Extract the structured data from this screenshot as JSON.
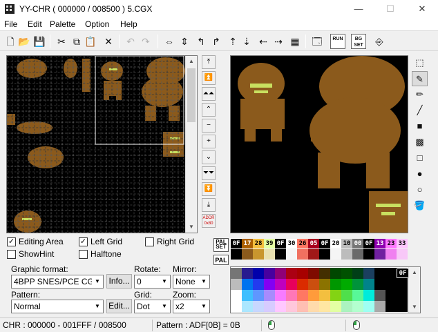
{
  "window": {
    "title": "YY-CHR ( 000000 / 008500 ) 5.CGX",
    "minimize": "—",
    "maximize": "☐",
    "close": "✕"
  },
  "menu": [
    {
      "label": "File",
      "key": "F"
    },
    {
      "label": "Edit",
      "key": "E"
    },
    {
      "label": "Palette",
      "key": "P"
    },
    {
      "label": "Option",
      "key": "O"
    },
    {
      "label": "Help",
      "key": "H"
    }
  ],
  "toolbar": [
    {
      "name": "new-icon",
      "glyph": "🗋",
      "enabled": true
    },
    {
      "name": "open-icon",
      "glyph": "📂",
      "enabled": true
    },
    {
      "name": "save-icon",
      "glyph": "💾",
      "enabled": true
    },
    {
      "name": "cut-icon",
      "glyph": "✂",
      "enabled": true
    },
    {
      "name": "copy-icon",
      "glyph": "⧉",
      "enabled": true
    },
    {
      "name": "paste-icon",
      "glyph": "📋",
      "enabled": true
    },
    {
      "name": "delete-icon",
      "glyph": "✕",
      "enabled": true
    },
    {
      "name": "undo-icon",
      "glyph": "↶",
      "enabled": false
    },
    {
      "name": "redo-icon",
      "glyph": "↷",
      "enabled": false
    },
    {
      "name": "flip-horizontal-icon",
      "glyph": "⇔",
      "enabled": true
    },
    {
      "name": "flip-vertical-icon",
      "glyph": "⇕",
      "enabled": true
    },
    {
      "name": "rotate-left-icon",
      "glyph": "↰",
      "enabled": true
    },
    {
      "name": "rotate-right-icon",
      "glyph": "↱",
      "enabled": true
    },
    {
      "name": "shift-up-icon",
      "glyph": "⇡",
      "enabled": true
    },
    {
      "name": "shift-down-icon",
      "glyph": "⇣",
      "enabled": true
    },
    {
      "name": "shift-left-icon",
      "glyph": "⇠",
      "enabled": true
    },
    {
      "name": "shift-right-icon",
      "glyph": "⇢",
      "enabled": true
    },
    {
      "name": "palette-icon",
      "glyph": "▦",
      "enabled": true
    },
    {
      "name": "properties-icon",
      "glyph": "🗔",
      "enabled": true
    },
    {
      "name": "run-script-icon",
      "glyph": "RUN",
      "enabled": true
    },
    {
      "name": "bg-set-icon",
      "glyph": "BG SET",
      "enabled": true
    },
    {
      "name": "exit-icon",
      "glyph": "⎆",
      "enabled": true
    }
  ],
  "navigation": [
    {
      "name": "page-top-button",
      "glyph": "⤒",
      "blue": false
    },
    {
      "name": "page-up-fast-button",
      "glyph": "⏫",
      "blue": true
    },
    {
      "name": "page-up-button",
      "glyph": "⏶⏶",
      "blue": false
    },
    {
      "name": "line-up-button",
      "glyph": "⌃",
      "blue": false
    },
    {
      "name": "byte-down-button",
      "glyph": "−",
      "blue": false
    },
    {
      "name": "byte-up-button",
      "glyph": "+",
      "blue": false
    },
    {
      "name": "line-down-button",
      "glyph": "⌄",
      "blue": false
    },
    {
      "name": "page-down-button",
      "glyph": "⏷⏷",
      "blue": false
    },
    {
      "name": "page-down-fast-button",
      "glyph": "⏬",
      "blue": true
    },
    {
      "name": "page-bottom-button",
      "glyph": "⤓",
      "blue": false
    },
    {
      "name": "address-button",
      "glyph": "",
      "blue": false
    }
  ],
  "address_button": {
    "line1": "ADDR",
    "line2": "0x80"
  },
  "drawtools": [
    {
      "name": "select-tool-icon",
      "glyph": "⬚",
      "active": false
    },
    {
      "name": "pen-tool-icon",
      "glyph": "✎",
      "active": true
    },
    {
      "name": "pencil-tool-icon",
      "glyph": "✏",
      "active": false
    },
    {
      "name": "line-tool-icon",
      "glyph": "╱",
      "active": false
    },
    {
      "name": "filled-rect-tool-icon",
      "glyph": "■",
      "active": false
    },
    {
      "name": "pattern-rect-tool-icon",
      "glyph": "▩",
      "active": false
    },
    {
      "name": "rect-tool-icon",
      "glyph": "□",
      "active": false
    },
    {
      "name": "filled-circle-tool-icon",
      "glyph": "●",
      "active": false
    },
    {
      "name": "circle-tool-icon",
      "glyph": "○",
      "active": false
    },
    {
      "name": "fill-tool-icon",
      "glyph": "🪣",
      "active": false
    }
  ],
  "options": {
    "editing_area": {
      "label": "Editing Area",
      "checked": true
    },
    "left_grid": {
      "label": "Left Grid",
      "checked": true
    },
    "right_grid": {
      "label": "Right Grid",
      "checked": false
    },
    "show_hint": {
      "label": "ShowHint",
      "checked": false
    },
    "halftone": {
      "label": "Halftone",
      "checked": false
    }
  },
  "graphic_format": {
    "label": "Graphic format:",
    "value": "4BPP SNES/PCE CG",
    "info_button": "Info..."
  },
  "rotate": {
    "label": "Rotate:",
    "value": "0"
  },
  "mirror": {
    "label": "Mirror:",
    "value": "None"
  },
  "pattern": {
    "label": "Pattern:",
    "value": "Normal",
    "edit_button": "Edit..."
  },
  "grid": {
    "label": "Grid:",
    "value": "Dot"
  },
  "zoom": {
    "label": "Zoom:",
    "value": "x2"
  },
  "palset": {
    "pal_set": "PAL SET",
    "pal": "PAL"
  },
  "palette_entries": [
    {
      "code": "0F",
      "color": "#000000",
      "text": "#ffffff",
      "sel": true
    },
    {
      "code": "17",
      "color": "#ab5f00",
      "text": "#ffffff"
    },
    {
      "code": "28",
      "color": "#f3bf3f",
      "text": "#000000"
    },
    {
      "code": "39",
      "color": "#e3ffa3",
      "text": "#000000"
    },
    {
      "code": "0F",
      "color": "#000000",
      "text": "#ffffff"
    },
    {
      "code": "30",
      "color": "#ffffff",
      "text": "#000000"
    },
    {
      "code": "26",
      "color": "#ff7763",
      "text": "#000000"
    },
    {
      "code": "05",
      "color": "#a7001f",
      "text": "#ffffff"
    },
    {
      "code": "0F",
      "color": "#000000",
      "text": "#ffffff"
    },
    {
      "code": "20",
      "color": "#ffffff",
      "text": "#000000"
    },
    {
      "code": "10",
      "color": "#bcbcbc",
      "text": "#000000"
    },
    {
      "code": "00",
      "color": "#757575",
      "text": "#ffffff"
    },
    {
      "code": "0F",
      "color": "#000000",
      "text": "#ffffff"
    },
    {
      "code": "13",
      "color": "#8f00b0",
      "text": "#ffffff"
    },
    {
      "code": "23",
      "color": "#ff77ff",
      "text": "#000000"
    },
    {
      "code": "33",
      "color": "#ffc7ff",
      "text": "#000000"
    }
  ],
  "palette_swatches": [
    "#000000",
    "#8b5a1c",
    "#c8962e",
    "#e8e0b0",
    "#000000",
    "#f5f5f5",
    "#f07060",
    "#a01818",
    "#000000",
    "#f5f5f5",
    "#bcbcbc",
    "#6a6a6a",
    "#000000",
    "#7020a0",
    "#f080f0",
    "#f8c8f8"
  ],
  "color_grid_label": "0F",
  "status": {
    "chr": "CHR : 000000 - 001FFF / 008500",
    "pattern": "Pattern : ADF[0B] = 0B"
  }
}
